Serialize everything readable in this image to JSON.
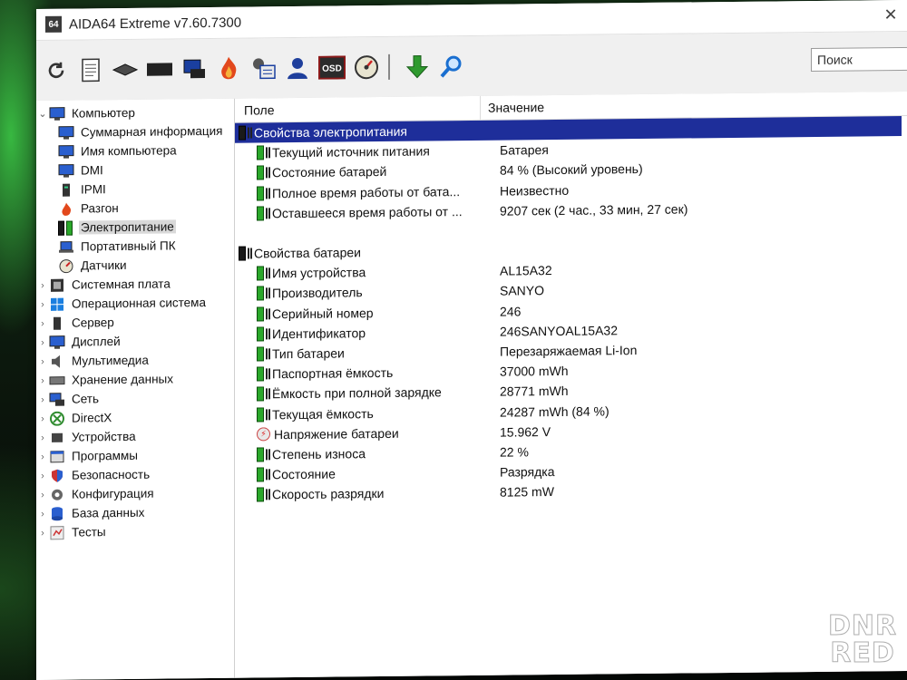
{
  "window": {
    "title": "AIDA64 Extreme v7.60.7300",
    "app_icon_text": "64",
    "close_glyph": "✕"
  },
  "toolbar": {
    "buttons": [
      "refresh-icon",
      "report-icon",
      "motherboard-icon",
      "memory-icon",
      "network-icon",
      "overclock-icon",
      "system-icon",
      "user-icon",
      "osd-icon",
      "speed-icon",
      "update-icon",
      "search-icon"
    ],
    "osd_label": "OSD",
    "search_placeholder": "Поиск"
  },
  "sidebar": {
    "root": "Компьютер",
    "children": [
      "Суммарная информация",
      "Имя компьютера",
      "DMI",
      "IPMI",
      "Разгон",
      "Электропитание",
      "Портативный ПК",
      "Датчики"
    ],
    "categories": [
      "Системная плата",
      "Операционная система",
      "Сервер",
      "Дисплей",
      "Мультимедиа",
      "Хранение данных",
      "Сеть",
      "DirectX",
      "Устройства",
      "Программы",
      "Безопасность",
      "Конфигурация",
      "База данных",
      "Тесты"
    ]
  },
  "table": {
    "col_field": "Поле",
    "col_value": "Значение",
    "sections": [
      {
        "title": "Свойства электропитания",
        "rows": [
          {
            "field": "Текущий источник питания",
            "value": "Батарея"
          },
          {
            "field": "Состояние батарей",
            "value": "84 % (Высокий уровень)"
          },
          {
            "field": "Полное время работы от бата...",
            "value": "Неизвестно"
          },
          {
            "field": "Оставшееся время работы от ...",
            "value": "9207 сек (2 час., 33 мин, 27 сек)"
          }
        ]
      },
      {
        "title": "Свойства батареи",
        "rows": [
          {
            "field": "Имя устройства",
            "value": "AL15A32"
          },
          {
            "field": "Производитель",
            "value": "SANYO"
          },
          {
            "field": "Серийный номер",
            "value": "246"
          },
          {
            "field": "Идентификатор",
            "value": "246SANYOAL15A32"
          },
          {
            "field": "Тип батареи",
            "value": "Перезаряжаемая Li-Ion"
          },
          {
            "field": "Паспортная ёмкость",
            "value": "37000 mWh"
          },
          {
            "field": "Ёмкость при полной зарядке",
            "value": "28771 mWh"
          },
          {
            "field": "Текущая ёмкость",
            "value": "24287 mWh  (84 %)"
          },
          {
            "field": "Напряжение батареи",
            "value": "15.962 V"
          },
          {
            "field": "Степень износа",
            "value": "22 %"
          },
          {
            "field": "Состояние",
            "value": "Разрядка"
          },
          {
            "field": "Скорость разрядки",
            "value": "8125 mW"
          }
        ]
      }
    ]
  },
  "watermark": {
    "line1": "DNR",
    "line2": "RED"
  },
  "colors": {
    "selection": "#1e2e9a",
    "battery_green": "#2aa82a"
  }
}
